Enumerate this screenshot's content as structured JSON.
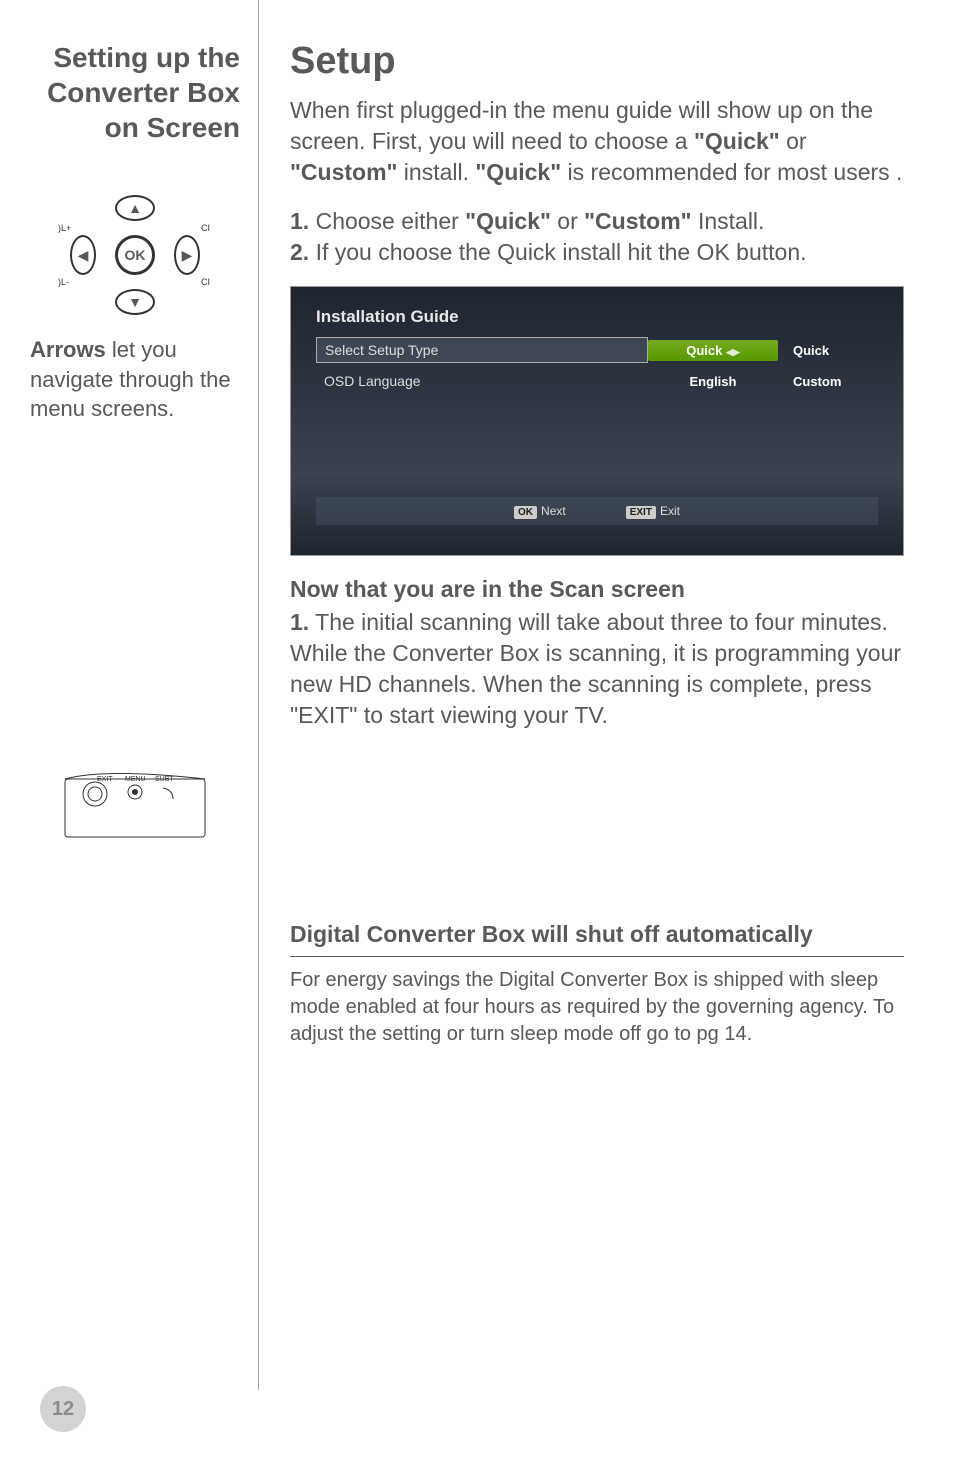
{
  "left": {
    "heading": "Setting up the Converter Box on Screen",
    "arrow_ok": "OK",
    "edge_tl": ")L+",
    "edge_bl": ")L-",
    "edge_tr": "CI",
    "edge_br": "CI",
    "arrows_caption_bold": "Arrows",
    "arrows_caption_rest": " let you navigate through the menu screens.",
    "box_labels": {
      "exit": "EXIT",
      "menu": "MENU",
      "subt": "SUBT"
    }
  },
  "right": {
    "heading": "Setup",
    "intro_1": "When first plugged-in the menu guide will show up on the screen. First, you will need to choose a ",
    "intro_q1": "\"Quick\"",
    "intro_or": " or ",
    "intro_c": "\"Custom\"",
    "intro_mid": " install. ",
    "intro_q2": "\"Quick\"",
    "intro_end": " is recommended for most users  .",
    "step1_num": "1.",
    "step1_a": " Choose either ",
    "step1_q": "\"Quick\"",
    "step1_or": " or ",
    "step1_c": "\"Custom\"",
    "step1_end": " Install.",
    "step2_num": "2.",
    "step2_text": " If you choose the Quick install hit the OK button.",
    "scan_heading": "Now that you are in the Scan screen",
    "scan_num": "1.",
    "scan_text": " The initial scanning will take about three to four minutes. While the Converter Box is scanning, it is programming your new HD channels. When the scanning is complete, press \"EXIT\" to start viewing your TV.",
    "shutoff_heading": "Digital Converter Box will shut off automatically",
    "shutoff_text": "For energy savings the Digital Converter Box is shipped with sleep mode enabled at four hours as required by the governing agency. To adjust the setting or turn sleep mode off go to pg 14."
  },
  "screenshot": {
    "title": "Installation Guide",
    "row1_label": "Select Setup Type",
    "row1_value": "Quick",
    "row1_arrows": "⯇ ⯈",
    "row2_label": "OSD Language",
    "row2_value": "English",
    "side_quick": "Quick",
    "side_custom": "Custom",
    "footer_ok_badge": "OK",
    "footer_ok_text": "Next",
    "footer_exit_badge": "EXIT",
    "footer_exit_text": "Exit"
  },
  "page_number": "12"
}
